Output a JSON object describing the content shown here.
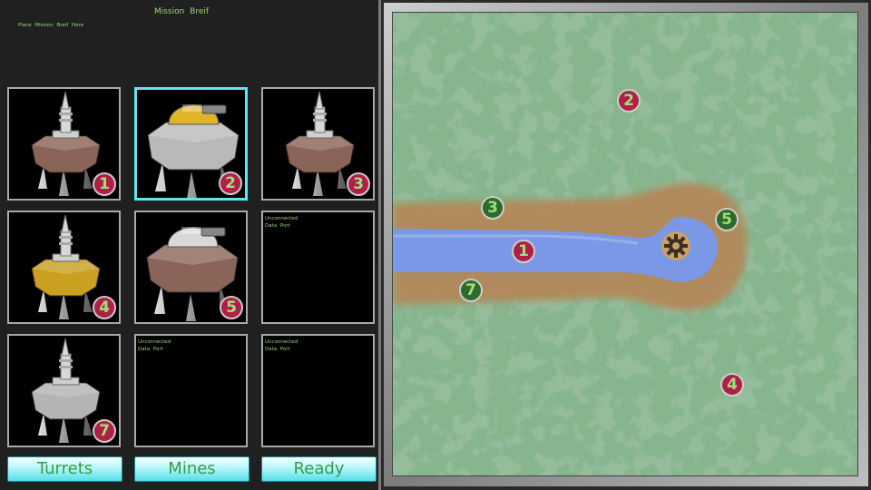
{
  "brief": {
    "title": "Mission Breif",
    "text": "Place Mission Breif Here"
  },
  "slots": [
    {
      "number": "1",
      "unit": "spire-turret",
      "hull_color": "#8a6458",
      "empty_line1": "",
      "empty_line2": ""
    },
    {
      "number": "2",
      "unit": "dome-turret",
      "hull_color": "#b9b9b9",
      "dome_color": "#e0b428",
      "empty_line1": "",
      "empty_line2": ""
    },
    {
      "number": "3",
      "unit": "spire-turret",
      "hull_color": "#8a6458",
      "empty_line1": "",
      "empty_line2": ""
    },
    {
      "number": "4",
      "unit": "spire-turret",
      "hull_color": "#c9a020",
      "empty_line1": "",
      "empty_line2": ""
    },
    {
      "number": "5",
      "unit": "dome-turret",
      "hull_color": "#8a6458",
      "dome_color": "#d8d8d8",
      "empty_line1": "",
      "empty_line2": ""
    },
    {
      "number": "",
      "unit": "empty",
      "empty_line1": "Unconnected",
      "empty_line2": "Data   Port"
    },
    {
      "number": "7",
      "unit": "spire-turret",
      "hull_color": "#b4b4b4",
      "empty_line1": "",
      "empty_line2": ""
    },
    {
      "number": "",
      "unit": "empty",
      "empty_line1": "Unconnected",
      "empty_line2": "Data   Port"
    },
    {
      "number": "",
      "unit": "empty",
      "empty_line1": "Unconnected",
      "empty_line2": "Data   Port"
    }
  ],
  "selected_slot": "2",
  "buttons": {
    "turrets": "Turrets",
    "mines": "Mines",
    "ready": "Ready"
  },
  "map": {
    "markers": [
      {
        "label": "2",
        "color": "red"
      },
      {
        "label": "3",
        "color": "green"
      },
      {
        "label": "1",
        "color": "red"
      },
      {
        "label": "5",
        "color": "green"
      },
      {
        "label": "7",
        "color": "green"
      },
      {
        "label": "4",
        "color": "red"
      }
    ],
    "base_icon": "gear-icon"
  },
  "colors": {
    "accent_cyan": "#5fe6ee",
    "badge_red": "#b01f48",
    "badge_green": "#2e6a2e",
    "label_green": "#9fd47a",
    "terrain_green": "#86b58e",
    "path_dirt": "#b08a5c",
    "water_blue": "#7b98e6"
  }
}
